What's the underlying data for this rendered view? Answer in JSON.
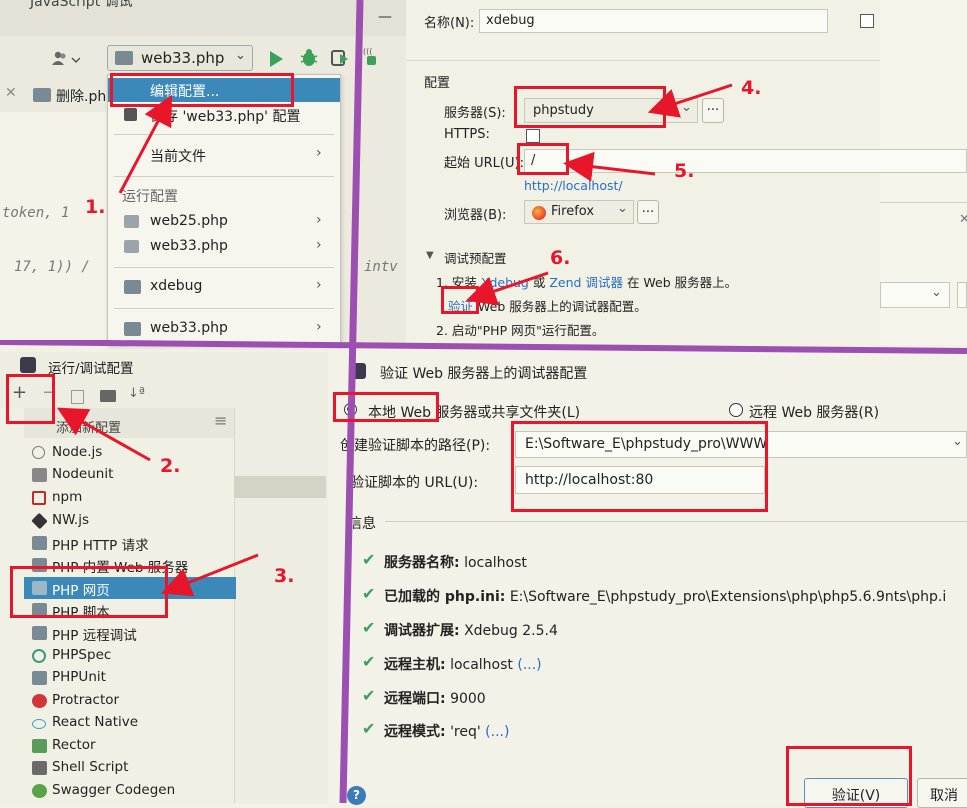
{
  "top_left": {
    "title_cut": "JavaScript 调试",
    "minimize": "—",
    "run_config": "web33.php",
    "tab_file": "删除.ph",
    "code_line1": "token, 1",
    "code_line2": "17, 1)) /",
    "code_right": "intv",
    "menu": {
      "edit": "编辑配置...",
      "save": "保存 'web33.php' 配置",
      "current": "当前文件",
      "section": "运行配置",
      "item1": "web25.php",
      "item2": "web33.php",
      "item3": "xdebug",
      "item4": "web33.php"
    }
  },
  "top_right": {
    "name_label": "名称(N):",
    "name_value": "xdebug",
    "config_section": "配置",
    "server_label": "服务器(S):",
    "server_value": "phpstudy",
    "https_label": "HTTPS:",
    "start_url_label": "起始 URL(U):",
    "start_url_value": "/",
    "full_url": "http://localhost/",
    "browser_label": "浏览器(B):",
    "browser_value": "Firefox",
    "debug_section": "调试预配置",
    "step1_pre": "1. 安装",
    "step1_xdebug": "Xdebug",
    "step1_or": "或",
    "step1_zend": "Zend 调试器",
    "step1_post": "在 Web 服务器上。",
    "verify_link": "验证",
    "verify_post": "Web 服务器上的调试器配置。",
    "step2": "2. 启动\"PHP 网页\"运行配置。",
    "ellipsis": "..."
  },
  "bottom_left": {
    "title": "运行/调试配置",
    "add_new": "添加新配置",
    "items": [
      "Node.js",
      "Nodeunit",
      "npm",
      "NW.js",
      "PHP HTTP 请求",
      "PHP 内置 Web 服务器",
      "PHP 网页",
      "PHP 脚本",
      "PHP 远程调试",
      "PHPSpec",
      "PHPUnit",
      "Protractor",
      "React Native",
      "Rector",
      "Shell Script",
      "Swagger Codegen"
    ]
  },
  "bottom_right": {
    "title": "验证 Web 服务器上的调试器配置",
    "local_radio": "本地 Web 服务器或共享文件夹(L)",
    "remote_radio": "远程 Web 服务器(R)",
    "path_label": "创建验证脚本的路径(P):",
    "path_value": "E:\\Software_E\\phpstudy_pro\\WWW",
    "url_label": "验证脚本的 URL(U):",
    "url_value": "http://localhost:80",
    "info_section": "信息",
    "info": [
      {
        "label": "服务器名称:",
        "value": "localhost",
        "link": ""
      },
      {
        "label": "已加载的 php.ini:",
        "value": "E:\\Software_E\\phpstudy_pro\\Extensions\\php\\php5.6.9nts\\php.i",
        "link": ""
      },
      {
        "label": "调试器扩展:",
        "value": "Xdebug 2.5.4",
        "link": ""
      },
      {
        "label": "远程主机:",
        "value": "localhost",
        "link": "(...)"
      },
      {
        "label": "远程端口:",
        "value": "9000",
        "link": ""
      },
      {
        "label": "远程模式:",
        "value": "'req'",
        "link": "(...)"
      }
    ],
    "verify_button": "验证(V)",
    "cancel_button": "取消"
  },
  "annotations": {
    "n1": "1.",
    "n2": "2.",
    "n3": "3.",
    "n4": "4.",
    "n5": "5.",
    "n6": "6."
  },
  "colors": {
    "background": "#f2f1e6",
    "selection": "#3c88b8",
    "annotation_red": "#e8162b",
    "divider_purple": "#9b4fb0",
    "link_blue": "#2a6fc2",
    "check_green": "#3aa05a"
  }
}
